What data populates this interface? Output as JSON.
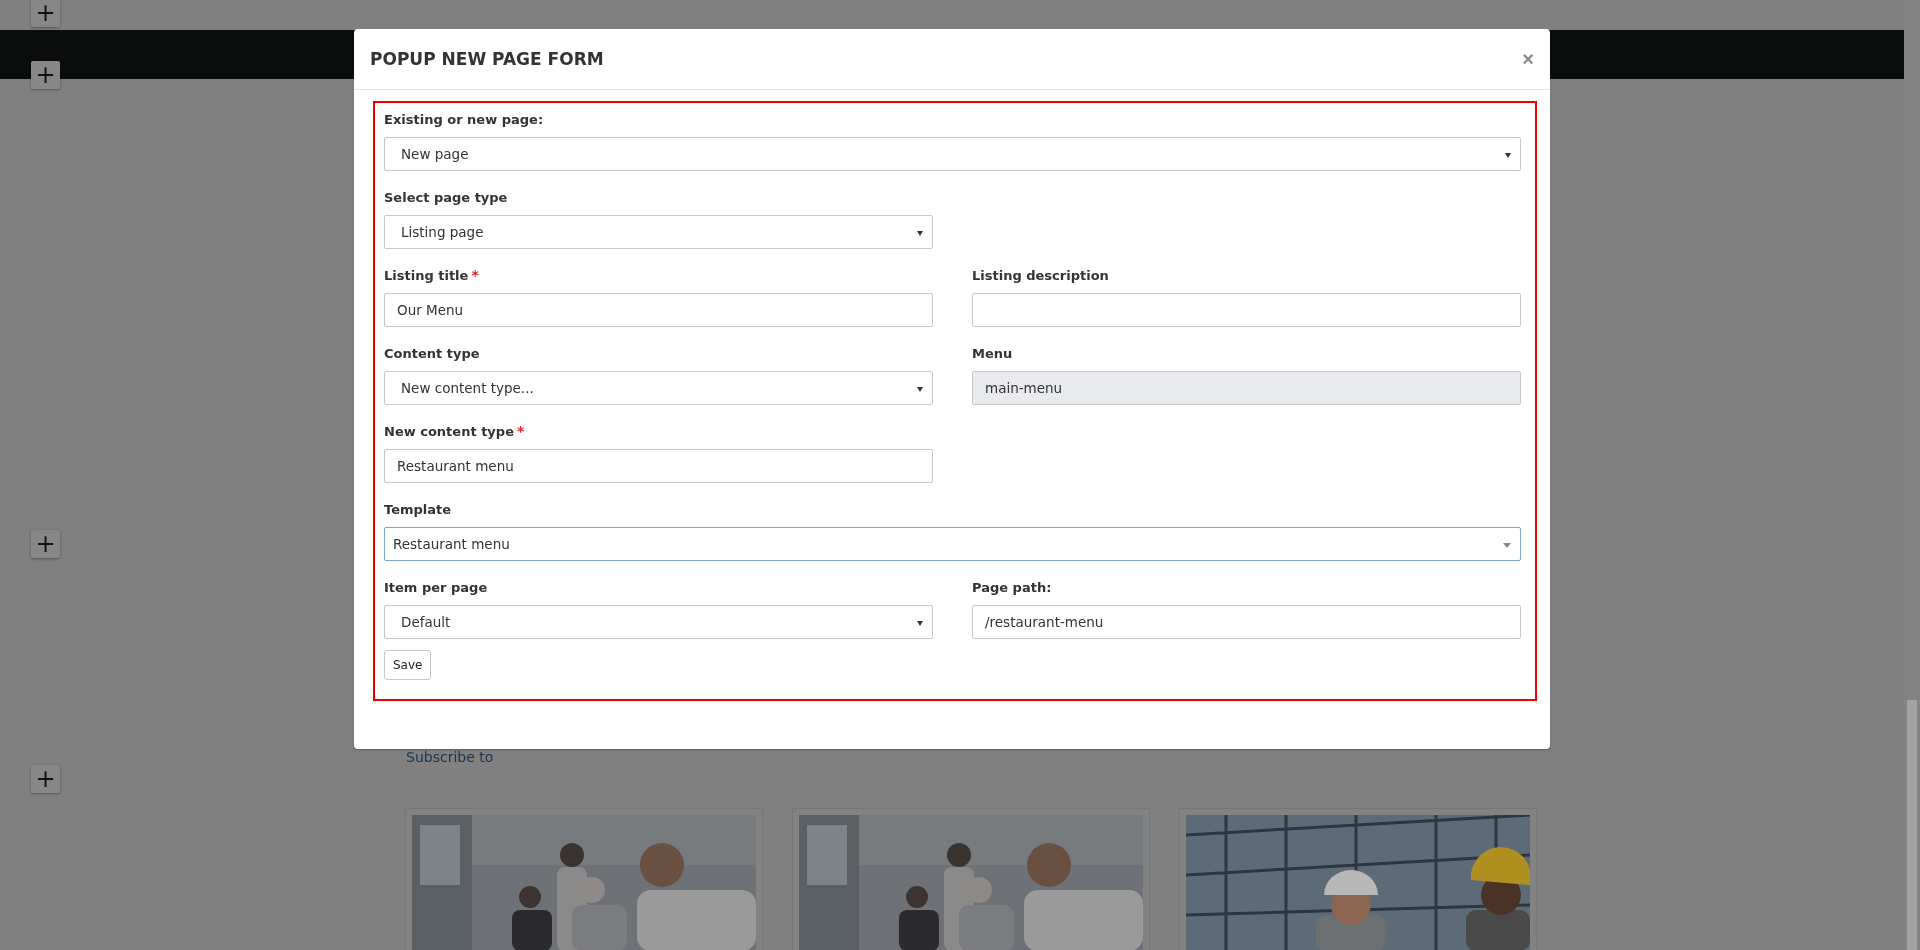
{
  "background": {
    "add_buttons": [
      "+",
      "+",
      "+",
      "+"
    ],
    "link": "Subscribe to"
  },
  "modal": {
    "title": "POPUP NEW PAGE FORM",
    "close": "×",
    "rows": [
      {
        "fields": [
          {
            "label": "Existing or new page:",
            "kind": "select",
            "value": "New page",
            "wide": true
          }
        ]
      },
      {
        "fields": [
          {
            "label": "Select page type",
            "kind": "select",
            "value": "Listing page",
            "wide": false
          }
        ]
      },
      {
        "fields": [
          {
            "label": "Listing title",
            "required_mark": "*",
            "kind": "input",
            "value": "Our Menu",
            "wide": false
          },
          {
            "label": "Listing description",
            "kind": "input",
            "wide": false
          }
        ]
      },
      {
        "fields": [
          {
            "label": "Content type",
            "kind": "select",
            "value": "New content type...",
            "wide": false
          },
          {
            "label": "Menu",
            "kind": "input",
            "value": "main-menu",
            "disabled": true,
            "wide": false
          }
        ]
      },
      {
        "fields": [
          {
            "label": "New content type",
            "required_mark": "*",
            "kind": "input",
            "value": "Restaurant menu",
            "wide": false
          }
        ]
      },
      {
        "fields": [
          {
            "label": "Template",
            "kind": "combo",
            "value": "Restaurant menu",
            "focused": true,
            "wide": true
          }
        ]
      },
      {
        "fields": [
          {
            "label": "Item per page",
            "kind": "select",
            "value": "Default",
            "wide": false
          },
          {
            "label": "Page path:",
            "kind": "input",
            "value": "/restaurant-menu",
            "wide": false
          }
        ]
      }
    ],
    "save": "Save"
  }
}
